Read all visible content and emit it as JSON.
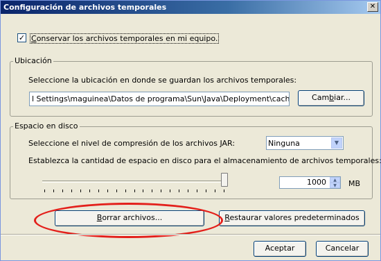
{
  "window": {
    "title": "Configuración de archivos temporales",
    "close_glyph": "✕"
  },
  "keep_files": {
    "checked": true,
    "check_glyph": "✓",
    "label_prefix": "",
    "label_accel": "C",
    "label_rest": "onservar los archivos temporales en mi equipo."
  },
  "location": {
    "group_title": "Ubicación",
    "instruction": "Seleccione la ubicación en donde se guardan los archivos temporales:",
    "path_value": "l Settings\\maguinea\\Datos de programa\\Sun\\Java\\Deployment\\cache",
    "change_button_prefix": "Cam",
    "change_button_accel": "b",
    "change_button_rest": "iar..."
  },
  "disk_space": {
    "group_title": "Espacio en disco",
    "compression_label": "Seleccione el nivel de compresión de los archivos JAR:",
    "compression_selected": "Ninguna",
    "amount_label": "Establezca la cantidad de espacio en disco para el almacenamiento de archivos temporales:",
    "slider_level_fraction": 1.0,
    "spin_value": "1000",
    "unit": "MB"
  },
  "actions": {
    "delete_prefix": "",
    "delete_accel": "B",
    "delete_rest": "orrar archivos...",
    "restore_prefix": "",
    "restore_accel": "R",
    "restore_rest": "estaurar valores predeterminados"
  },
  "footer": {
    "ok_label": "Aceptar",
    "cancel_label": "Cancelar"
  },
  "annotation": {
    "color": "#e3201b"
  }
}
